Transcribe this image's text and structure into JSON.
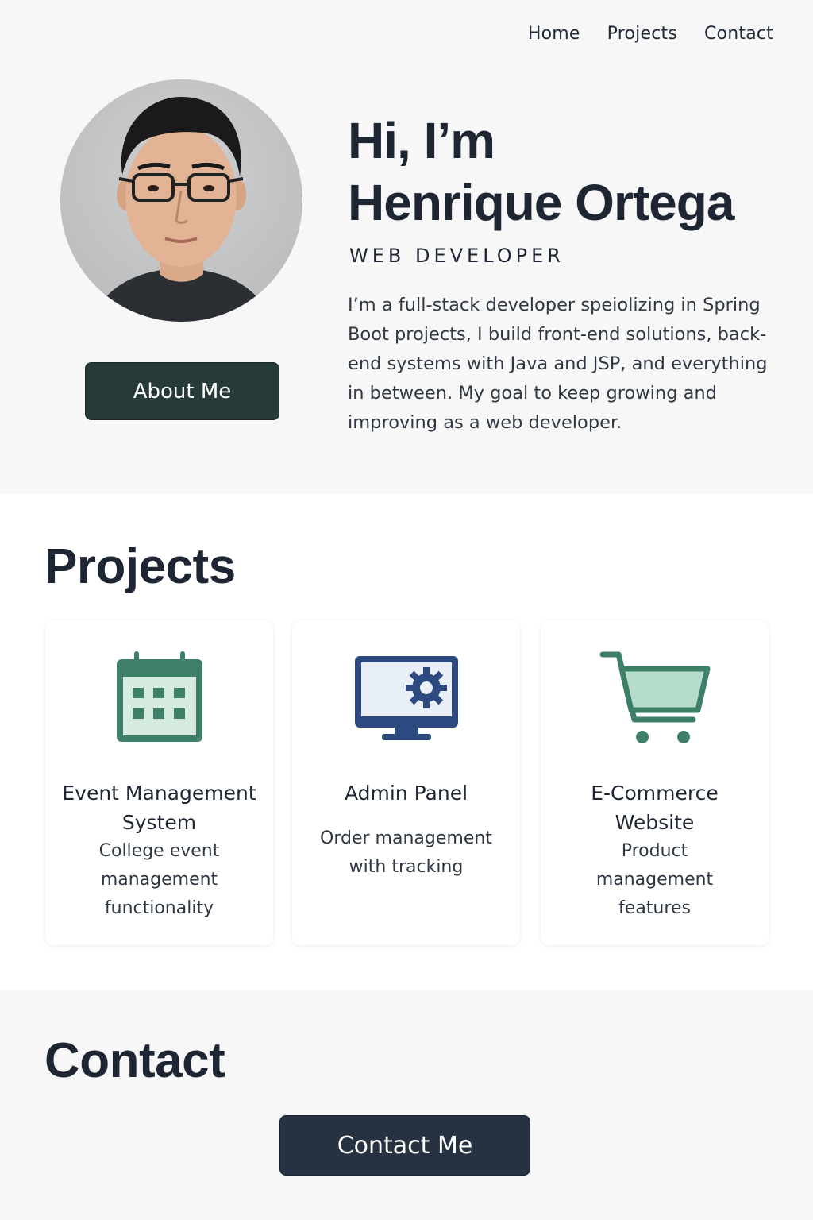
{
  "nav": {
    "items": [
      "Home",
      "Projects",
      "Contact"
    ]
  },
  "hero": {
    "title_line1": "Hi, I’m",
    "title_line2": "Henrique Ortega",
    "role": "WEB DEVELOPER",
    "description": "I’m a full-stack developer speiolizing in Spring Boot projects, I build front-end solutions, back-end systems with Java and JSP, and everything in between. My goal to keep growing and improving as a web developer.",
    "about_button": "About Me",
    "avatar_icon": "profile-photo"
  },
  "projects": {
    "title": "Projects",
    "cards": [
      {
        "title": "Event Management System",
        "description": "College event management functionality",
        "icon": "calendar-icon"
      },
      {
        "title": "Admin Panel",
        "description": "Order management with tracking",
        "icon": "monitor-gear-icon"
      },
      {
        "title": "E-Commerce Website",
        "description": "Product management features",
        "icon": "shopping-cart-icon"
      }
    ]
  },
  "contact": {
    "title": "Contact",
    "button": "Contact Me"
  },
  "colors": {
    "text_dark": "#1e2633",
    "about_button": "#263a38",
    "contact_button": "#263241",
    "green_icon": "#3e7f68",
    "blue_icon": "#2c4a7f"
  }
}
